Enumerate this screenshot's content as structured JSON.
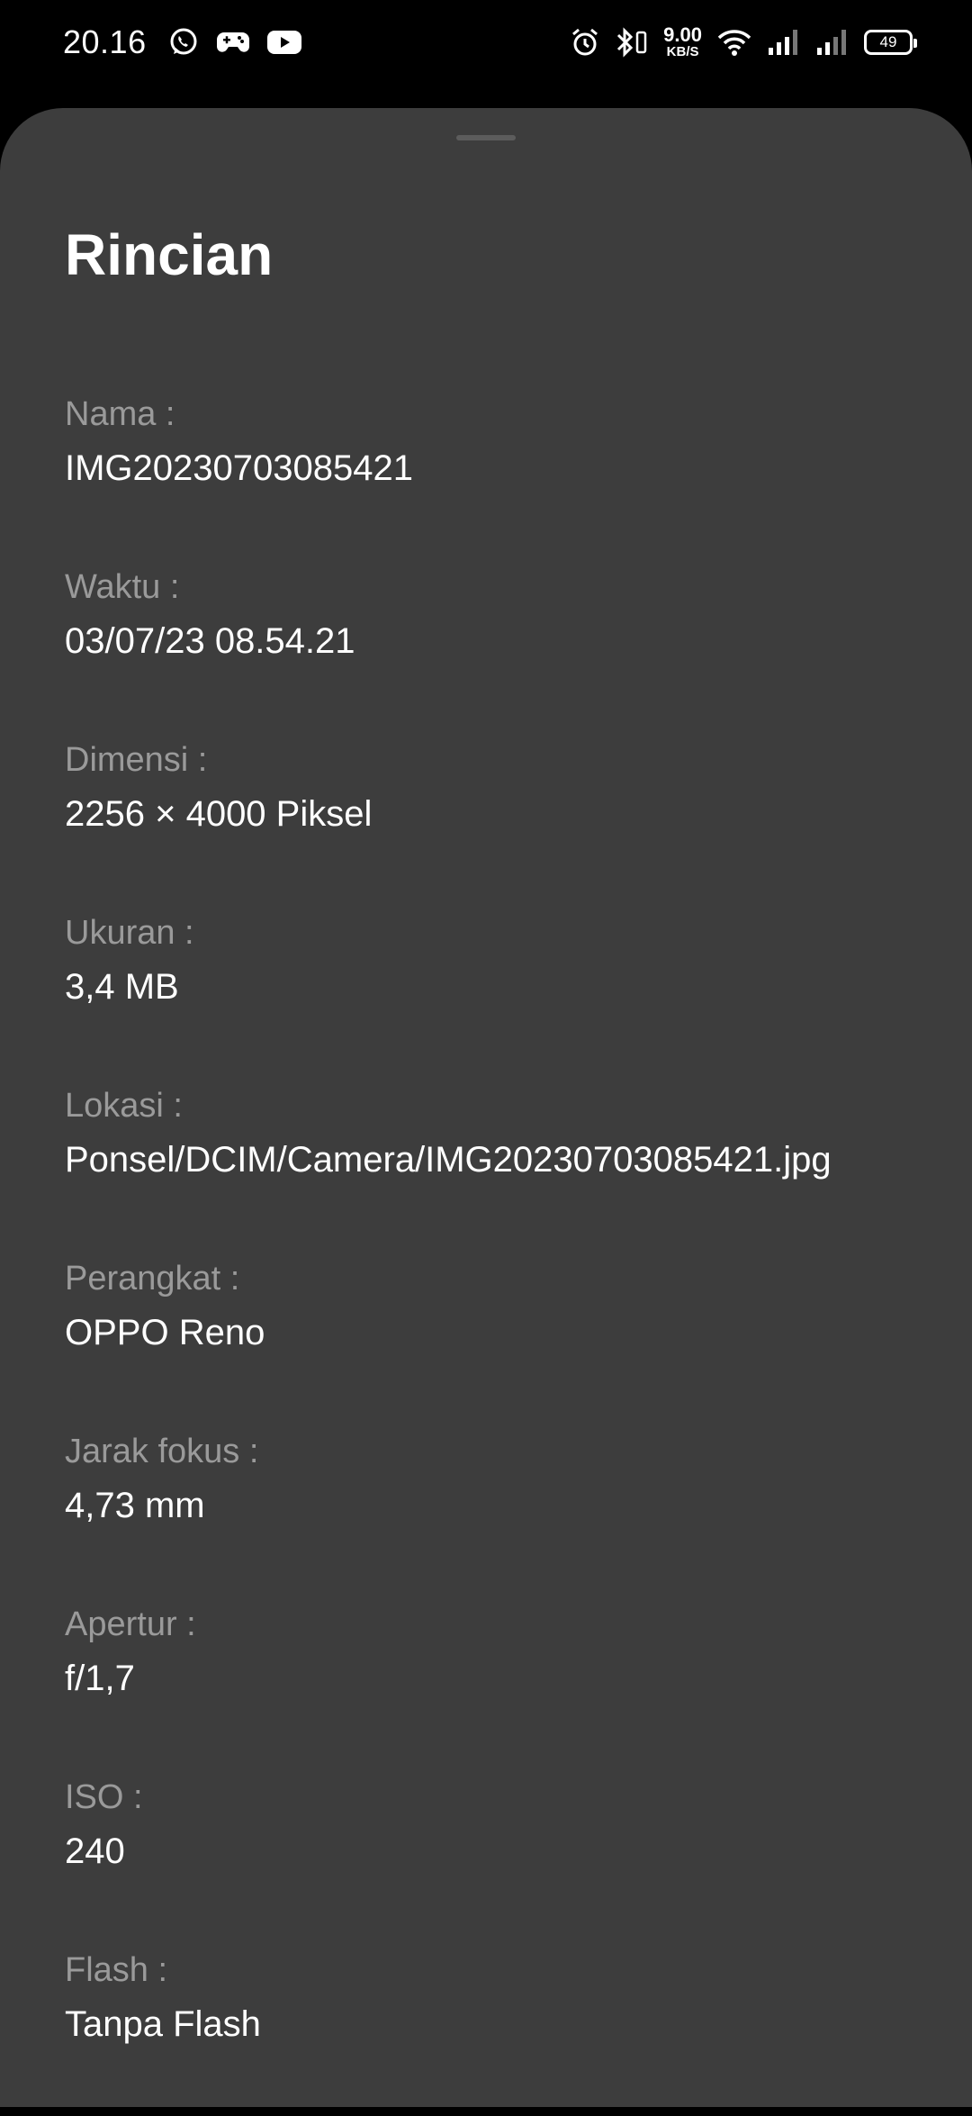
{
  "status_bar": {
    "time": "20.16",
    "net_speed_value": "9.00",
    "net_speed_unit": "KB/S",
    "battery_level": "49",
    "icons_left": [
      "whatsapp-icon",
      "gamepad-icon",
      "youtube-icon"
    ],
    "icons_right": [
      "alarm-icon",
      "bluetooth-icon",
      "wifi-icon",
      "signal-icon",
      "signal-icon"
    ]
  },
  "sheet": {
    "title": "Rincian",
    "details": [
      {
        "label": "Nama :",
        "value": "IMG20230703085421"
      },
      {
        "label": "Waktu :",
        "value": "03/07/23 08.54.21"
      },
      {
        "label": "Dimensi :",
        "value": "2256 × 4000 Piksel"
      },
      {
        "label": "Ukuran :",
        "value": "3,4 MB"
      },
      {
        "label": "Lokasi :",
        "value": "Ponsel/DCIM/Camera/IMG20230703085421.jpg"
      },
      {
        "label": "Perangkat :",
        "value": "OPPO Reno"
      },
      {
        "label": "Jarak fokus :",
        "value": "4,73 mm"
      },
      {
        "label": "Apertur :",
        "value": "f/1,7"
      },
      {
        "label": "ISO :",
        "value": "240"
      },
      {
        "label": "Flash :",
        "value": "Tanpa Flash"
      }
    ]
  },
  "colors": {
    "status_bar_bg": "#000000",
    "sheet_bg": "#3d3d3d",
    "label": "#9a9a9a",
    "value": "#ffffff"
  }
}
